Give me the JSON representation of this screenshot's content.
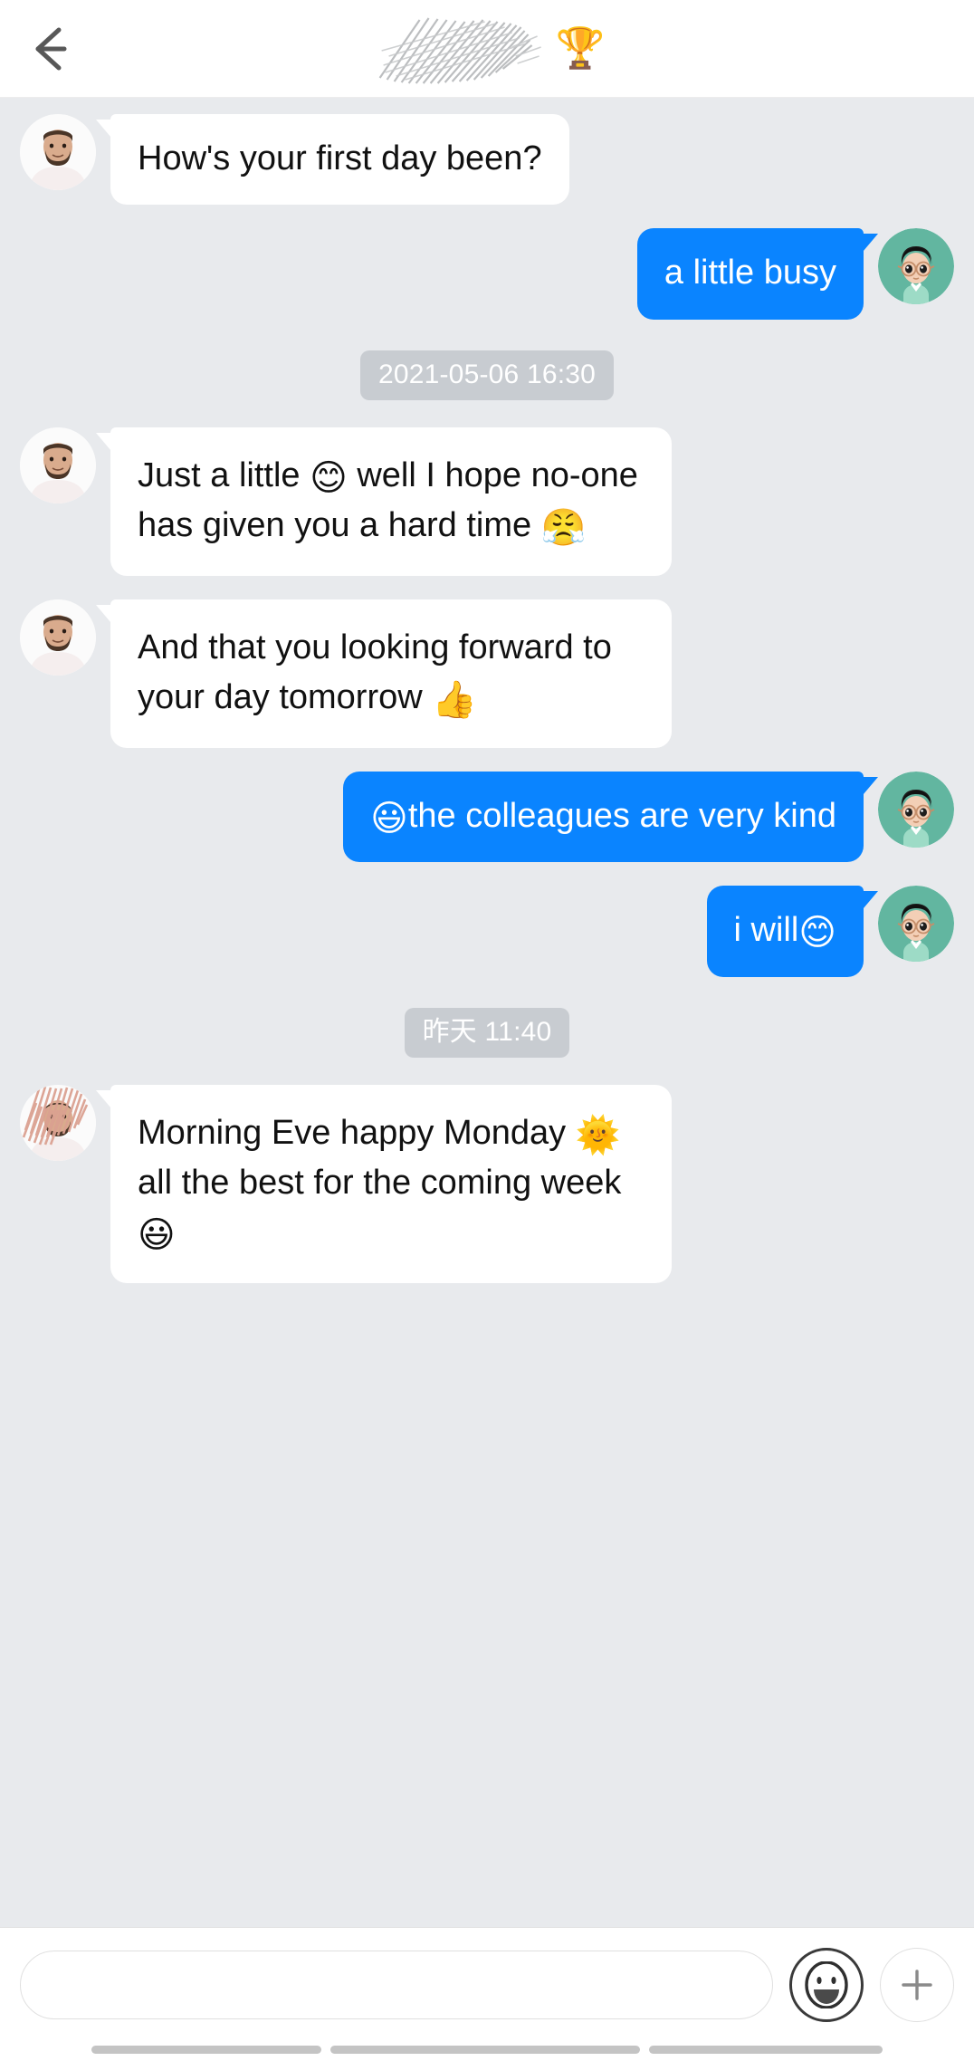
{
  "header": {
    "back_icon": "back-arrow-icon",
    "contact_name": "",
    "contact_name_redacted": true,
    "badge_emoji": "🏆",
    "badge_name": "trophy-emoji"
  },
  "colors": {
    "background": "#e8eaed",
    "outgoing_bubble": "#0a84ff",
    "incoming_bubble": "#ffffff",
    "outgoing_text": "#ffffff",
    "incoming_text": "#111111",
    "timestamp_pill": "#c8ccd1",
    "timestamp_text": "#ffffff",
    "avatar_ring": "#62b6a0",
    "header_background": "#ffffff"
  },
  "messages": [
    {
      "id": "msg-1",
      "side": "incoming",
      "avatar": "bearded-man-photo-avatar",
      "text": "How's your first day been?",
      "parts": [
        {
          "type": "text",
          "value": "How's your first day been?"
        }
      ]
    },
    {
      "id": "msg-2",
      "side": "outgoing",
      "avatar": "cartoon-glasses-avatar",
      "text": "a little busy",
      "parts": [
        {
          "type": "text",
          "value": "a little busy"
        }
      ]
    },
    {
      "id": "divider-1",
      "side": "divider",
      "text": "2021-05-06 16:30"
    },
    {
      "id": "msg-3",
      "side": "incoming",
      "avatar": "bearded-man-photo-avatar",
      "text": "Just a little 😊 well I hope no-one has given you a hard time 😤",
      "parts": [
        {
          "type": "text",
          "value": "Just a little "
        },
        {
          "type": "emoji",
          "value": "😊",
          "name": "smiling-face-smiling-eyes-emoji"
        },
        {
          "type": "text",
          "value": " well I hope no-one has given you a hard time "
        },
        {
          "type": "emoji",
          "value": "😤",
          "name": "face-with-steam-from-nose-emoji"
        }
      ]
    },
    {
      "id": "msg-4",
      "side": "incoming",
      "avatar": "bearded-man-photo-avatar",
      "text": "And that you looking forward to your day tomorrow 👍",
      "parts": [
        {
          "type": "text",
          "value": "And that you looking forward to your day tomorrow "
        },
        {
          "type": "emoji",
          "value": "👍",
          "name": "thumbs-up-emoji"
        }
      ]
    },
    {
      "id": "msg-5",
      "side": "outgoing",
      "avatar": "cartoon-glasses-avatar",
      "text": "😃the colleagues are very kind",
      "parts": [
        {
          "type": "emoji",
          "value": "😃",
          "name": "grinning-face-big-eyes-emoji"
        },
        {
          "type": "text",
          "value": "the colleagues are very kind"
        }
      ]
    },
    {
      "id": "msg-6",
      "side": "outgoing",
      "avatar": "cartoon-glasses-avatar",
      "text": "i will😊",
      "parts": [
        {
          "type": "text",
          "value": "i will"
        },
        {
          "type": "emoji",
          "value": "😊",
          "name": "smiling-face-smiling-eyes-emoji"
        }
      ]
    },
    {
      "id": "divider-2",
      "side": "divider",
      "text": "昨天 11:40"
    },
    {
      "id": "msg-7",
      "side": "incoming",
      "avatar": "bearded-man-photo-avatar-redacted",
      "text": "Morning Eve happy Monday 🌞all the best for the coming week 😃",
      "parts": [
        {
          "type": "text",
          "value": "Morning Eve happy Monday "
        },
        {
          "type": "emoji",
          "value": "🌞",
          "name": "sun-with-face-emoji"
        },
        {
          "type": "text",
          "value": "all the best for the coming week "
        },
        {
          "type": "emoji",
          "value": "😃",
          "name": "grinning-face-big-eyes-emoji"
        }
      ]
    }
  ],
  "m1_text": "How's your first day been?",
  "m2_text": "a little busy",
  "d1_text": "2021-05-06 16:30",
  "m3_a": "Just a little ",
  "m3_e1": "😊",
  "m3_b": " well I hope no-one has given you a ",
  "m3_c": "hard time ",
  "m3_e2": "😤",
  "m4_a": "And that you looking forward to your day ",
  "m4_b": "tomorrow ",
  "m4_e1": "👍",
  "m5_e1": "😃",
  "m5_a": "the colleagues are very kind",
  "m6_a": "i will",
  "m6_e1": "😊",
  "d2_text": "昨天 11:40",
  "m7_a": "Morning Eve happy ",
  "m7_b": "Monday ",
  "m7_e1": "🌞",
  "m7_c": "all the best ",
  "m7_d": "for the coming week ",
  "m7_e2": "😃",
  "composer": {
    "input_value": "",
    "input_placeholder": "",
    "emoji_button_name": "emoji-picker-button",
    "plus_button_name": "add-attachment-button"
  },
  "navigation": {
    "bars": [
      "recents-bar",
      "home-bar",
      "back-bar"
    ]
  }
}
